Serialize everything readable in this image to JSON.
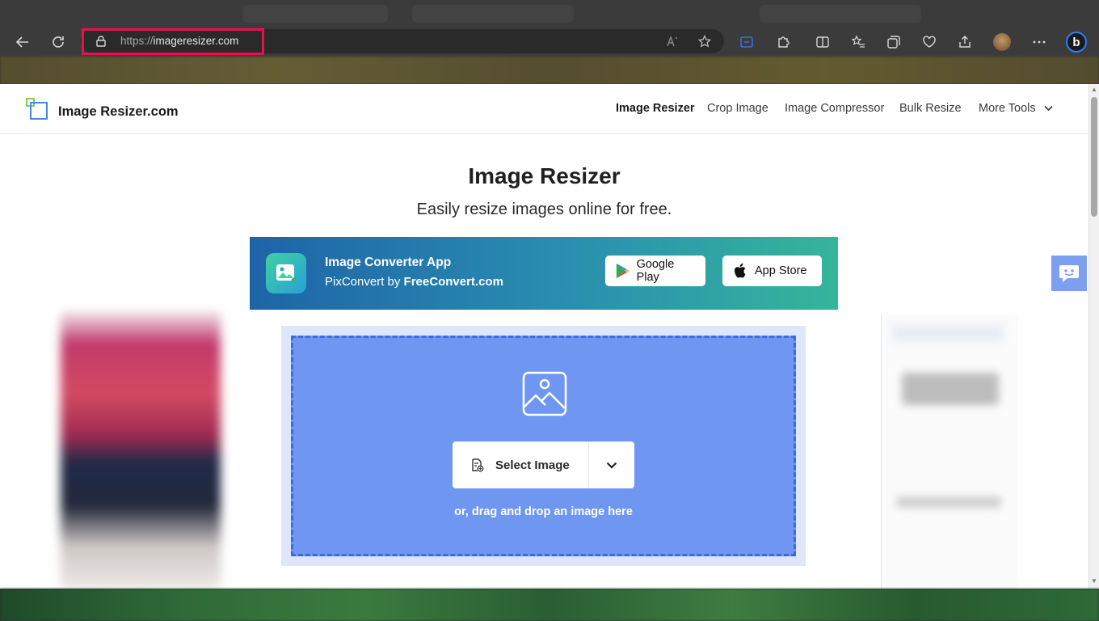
{
  "browser": {
    "url_scheme": "https://",
    "url_host": "imageresizer.com"
  },
  "site": {
    "logo_text": "Image Resizer.com",
    "nav": [
      {
        "label": "Image Resizer"
      },
      {
        "label": "Crop Image"
      },
      {
        "label": "Image Compressor"
      },
      {
        "label": "Bulk Resize"
      },
      {
        "label": "More Tools"
      }
    ]
  },
  "hero": {
    "title": "Image Resizer",
    "subtitle": "Easily resize images online for free."
  },
  "banner": {
    "title": "Image Converter App",
    "sub_prefix": "PixConvert by ",
    "sub_brand": "FreeConvert.com",
    "google_play": "Google Play",
    "app_store": "App Store"
  },
  "upload": {
    "select_label": "Select Image",
    "drag_text": "or, drag and drop an image here"
  },
  "colors": {
    "drop_zone": "#6f97f1",
    "url_highlight": "#e8114d",
    "banner_start": "#1d64a8",
    "banner_end": "#35b59a"
  }
}
